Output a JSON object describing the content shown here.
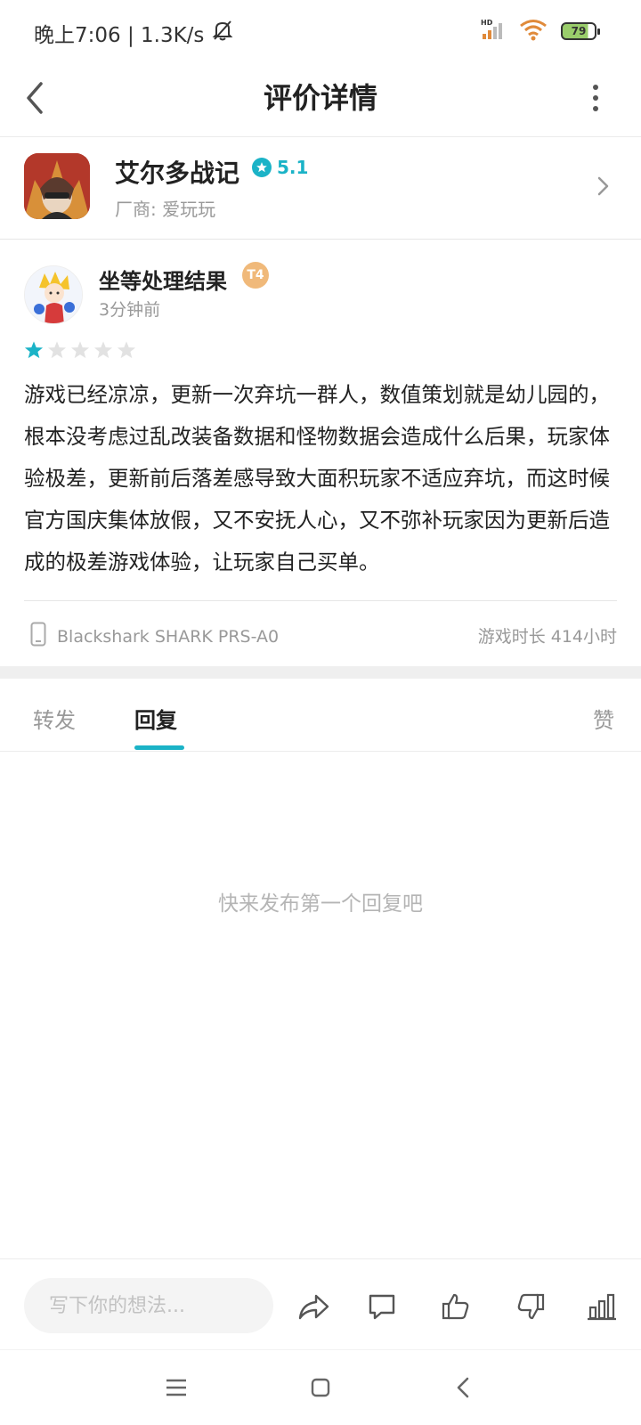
{
  "status_bar": {
    "time_speed": "晚上7:06 | 1.3K/s",
    "hd_label": "HD",
    "battery": "79",
    "battery_color": "#9acd6b"
  },
  "nav": {
    "title": "评价详情",
    "back_icon": "chevron-left-icon",
    "more_icon": "vertical-dots-icon"
  },
  "game": {
    "name": "艾尔多战记",
    "rating": "5.1",
    "vendor": "厂商: 爱玩玩",
    "accent_color": "#1bb3c7"
  },
  "review": {
    "username": "坐等处理结果",
    "badge": "T4",
    "time": "3分钟前",
    "stars": 1,
    "max_stars": 5,
    "text": "游戏已经凉凉，更新一次弃坑一群人，数值策划就是幼儿园的，根本没考虑过乱改装备数据和怪物数据会造成什么后果，玩家体验极差，更新前后落差感导致大面积玩家不适应弃坑，而这时候官方国庆集体放假，又不安抚人心，又不弥补玩家因为更新后造成的极差游戏体验，让玩家自己买单。",
    "device": "Blackshark SHARK PRS-A0",
    "playtime": "游戏时长 414小时"
  },
  "tabs": [
    {
      "label": "转发"
    },
    {
      "label": "回复"
    },
    {
      "label": "赞"
    }
  ],
  "empty_state": "快来发布第一个回复吧",
  "bottom_bar": {
    "input_placeholder": "写下你的想法...",
    "icons": [
      "share-icon",
      "comment-icon",
      "thumbs-up-icon",
      "thumbs-down-icon",
      "bar-chart-icon"
    ]
  },
  "system_nav": {
    "icons": [
      "menu-icon",
      "home-icon",
      "back-icon"
    ]
  }
}
